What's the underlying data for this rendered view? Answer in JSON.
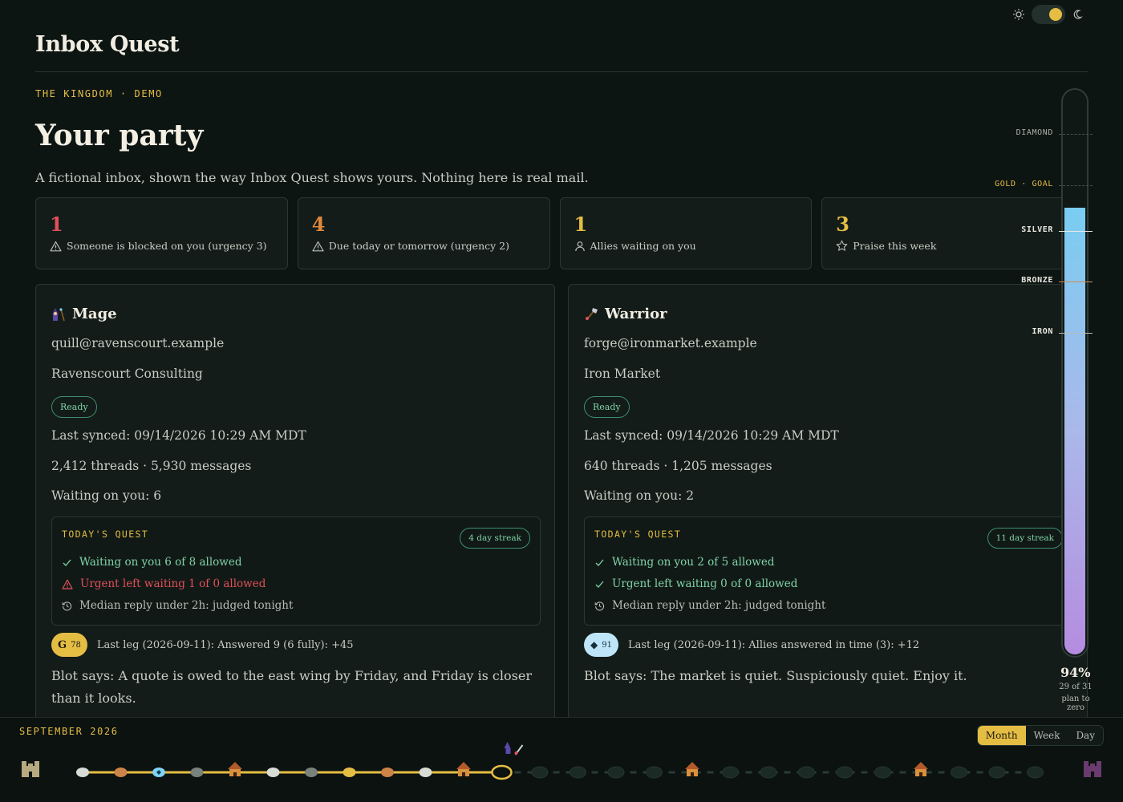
{
  "app": {
    "title": "Inbox Quest"
  },
  "eyebrow": "THE KINGDOM · DEMO",
  "page": {
    "title": "Your party",
    "subtitle": "A fictional inbox, shown the way Inbox Quest shows yours. Nothing here is real mail."
  },
  "stats": [
    {
      "value": "1",
      "label": "Someone is blocked on you (urgency 3)",
      "icon": "warning-icon",
      "color": "#e0505a"
    },
    {
      "value": "4",
      "label": "Due today or tomorrow (urgency 2)",
      "icon": "warning-icon",
      "color": "#e0883a"
    },
    {
      "value": "1",
      "label": "Allies waiting on you",
      "icon": "person-icon",
      "color": "#e4bd43"
    },
    {
      "value": "3",
      "label": "Praise this week",
      "icon": "star-icon",
      "color": "#e4bd43"
    }
  ],
  "accounts": [
    {
      "name": "Mage",
      "icon": "mage-icon",
      "email": "quill@ravenscourt.example",
      "org": "Ravenscourt Consulting",
      "status": "Ready",
      "synced": "Last synced: 09/14/2026 10:29 AM MDT",
      "counts": "2,412 threads · 5,930 messages",
      "waiting": "Waiting on you: 6",
      "quest": {
        "title": "TODAY'S QUEST",
        "streak": "4 day streak",
        "items": [
          {
            "text": "Waiting on you 6 of 8 allowed",
            "state": "ok"
          },
          {
            "text": "Urgent left waiting 1 of 0 allowed",
            "state": "bad"
          },
          {
            "text": "Median reply under 2h: judged tonight",
            "state": "pending"
          }
        ]
      },
      "leg_badge": {
        "glyph": "G",
        "value": "78",
        "color": "#e4bd43"
      },
      "leg": "Last leg (2026-09-11): Answered 9 (6 fully): +45",
      "blot": "Blot says: A quote is owed to the east wing by Friday, and Friday is closer than it looks."
    },
    {
      "name": "Warrior",
      "icon": "warrior-icon",
      "email": "forge@ironmarket.example",
      "org": "Iron Market",
      "status": "Ready",
      "synced": "Last synced: 09/14/2026 10:29 AM MDT",
      "counts": "640 threads · 1,205 messages",
      "waiting": "Waiting on you: 2",
      "quest": {
        "title": "TODAY'S QUEST",
        "streak": "11 day streak",
        "items": [
          {
            "text": "Waiting on you 2 of 5 allowed",
            "state": "ok"
          },
          {
            "text": "Urgent left waiting 0 of 0 allowed",
            "state": "ok"
          },
          {
            "text": "Median reply under 2h: judged tonight",
            "state": "pending"
          }
        ]
      },
      "leg_badge": {
        "glyph": "◆",
        "value": "91",
        "color": "#8fd0f0"
      },
      "leg": "Last leg (2026-09-11): Allies answered in time (3): +12",
      "blot": "Blot says: The market is quiet. Suspiciously quiet. Enjoy it."
    }
  ],
  "thermometer": {
    "tiers": [
      {
        "label": "DIAMOND",
        "level": 0.92,
        "color": "#a9b0a8",
        "reached": false
      },
      {
        "label": "GOLD · GOAL",
        "level": 0.83,
        "color": "#e4bd43",
        "reached": false
      },
      {
        "label": "SILVER",
        "level": 0.75,
        "color": "#e6e6e6",
        "reached": true
      },
      {
        "label": "BRONZE",
        "level": 0.66,
        "color": "#d48a4c",
        "reached": true
      },
      {
        "label": "IRON",
        "level": 0.57,
        "color": "#b8bdb5",
        "reached": true
      }
    ],
    "fill_level": 0.79,
    "percent": "94%",
    "progress": "29 of 31",
    "caption": "plan to zero"
  },
  "timeline": {
    "month": "SEPTEMBER 2026",
    "views": [
      "Month",
      "Week",
      "Day"
    ],
    "active_view": "Month",
    "start_icon": "castle-icon",
    "end_icon": "dark-castle-icon",
    "days": [
      "silver",
      "bronze",
      "diamond",
      "iron",
      "house",
      "silver",
      "iron",
      "gold",
      "bronze",
      "silver",
      "house",
      "today",
      "future",
      "future",
      "future",
      "future",
      "house",
      "future",
      "future",
      "future",
      "future",
      "future",
      "house",
      "future",
      "future",
      "future"
    ]
  },
  "colors": {
    "accent": "#e4bd43",
    "ok": "#7fd3a8",
    "bad": "#e0505a"
  }
}
